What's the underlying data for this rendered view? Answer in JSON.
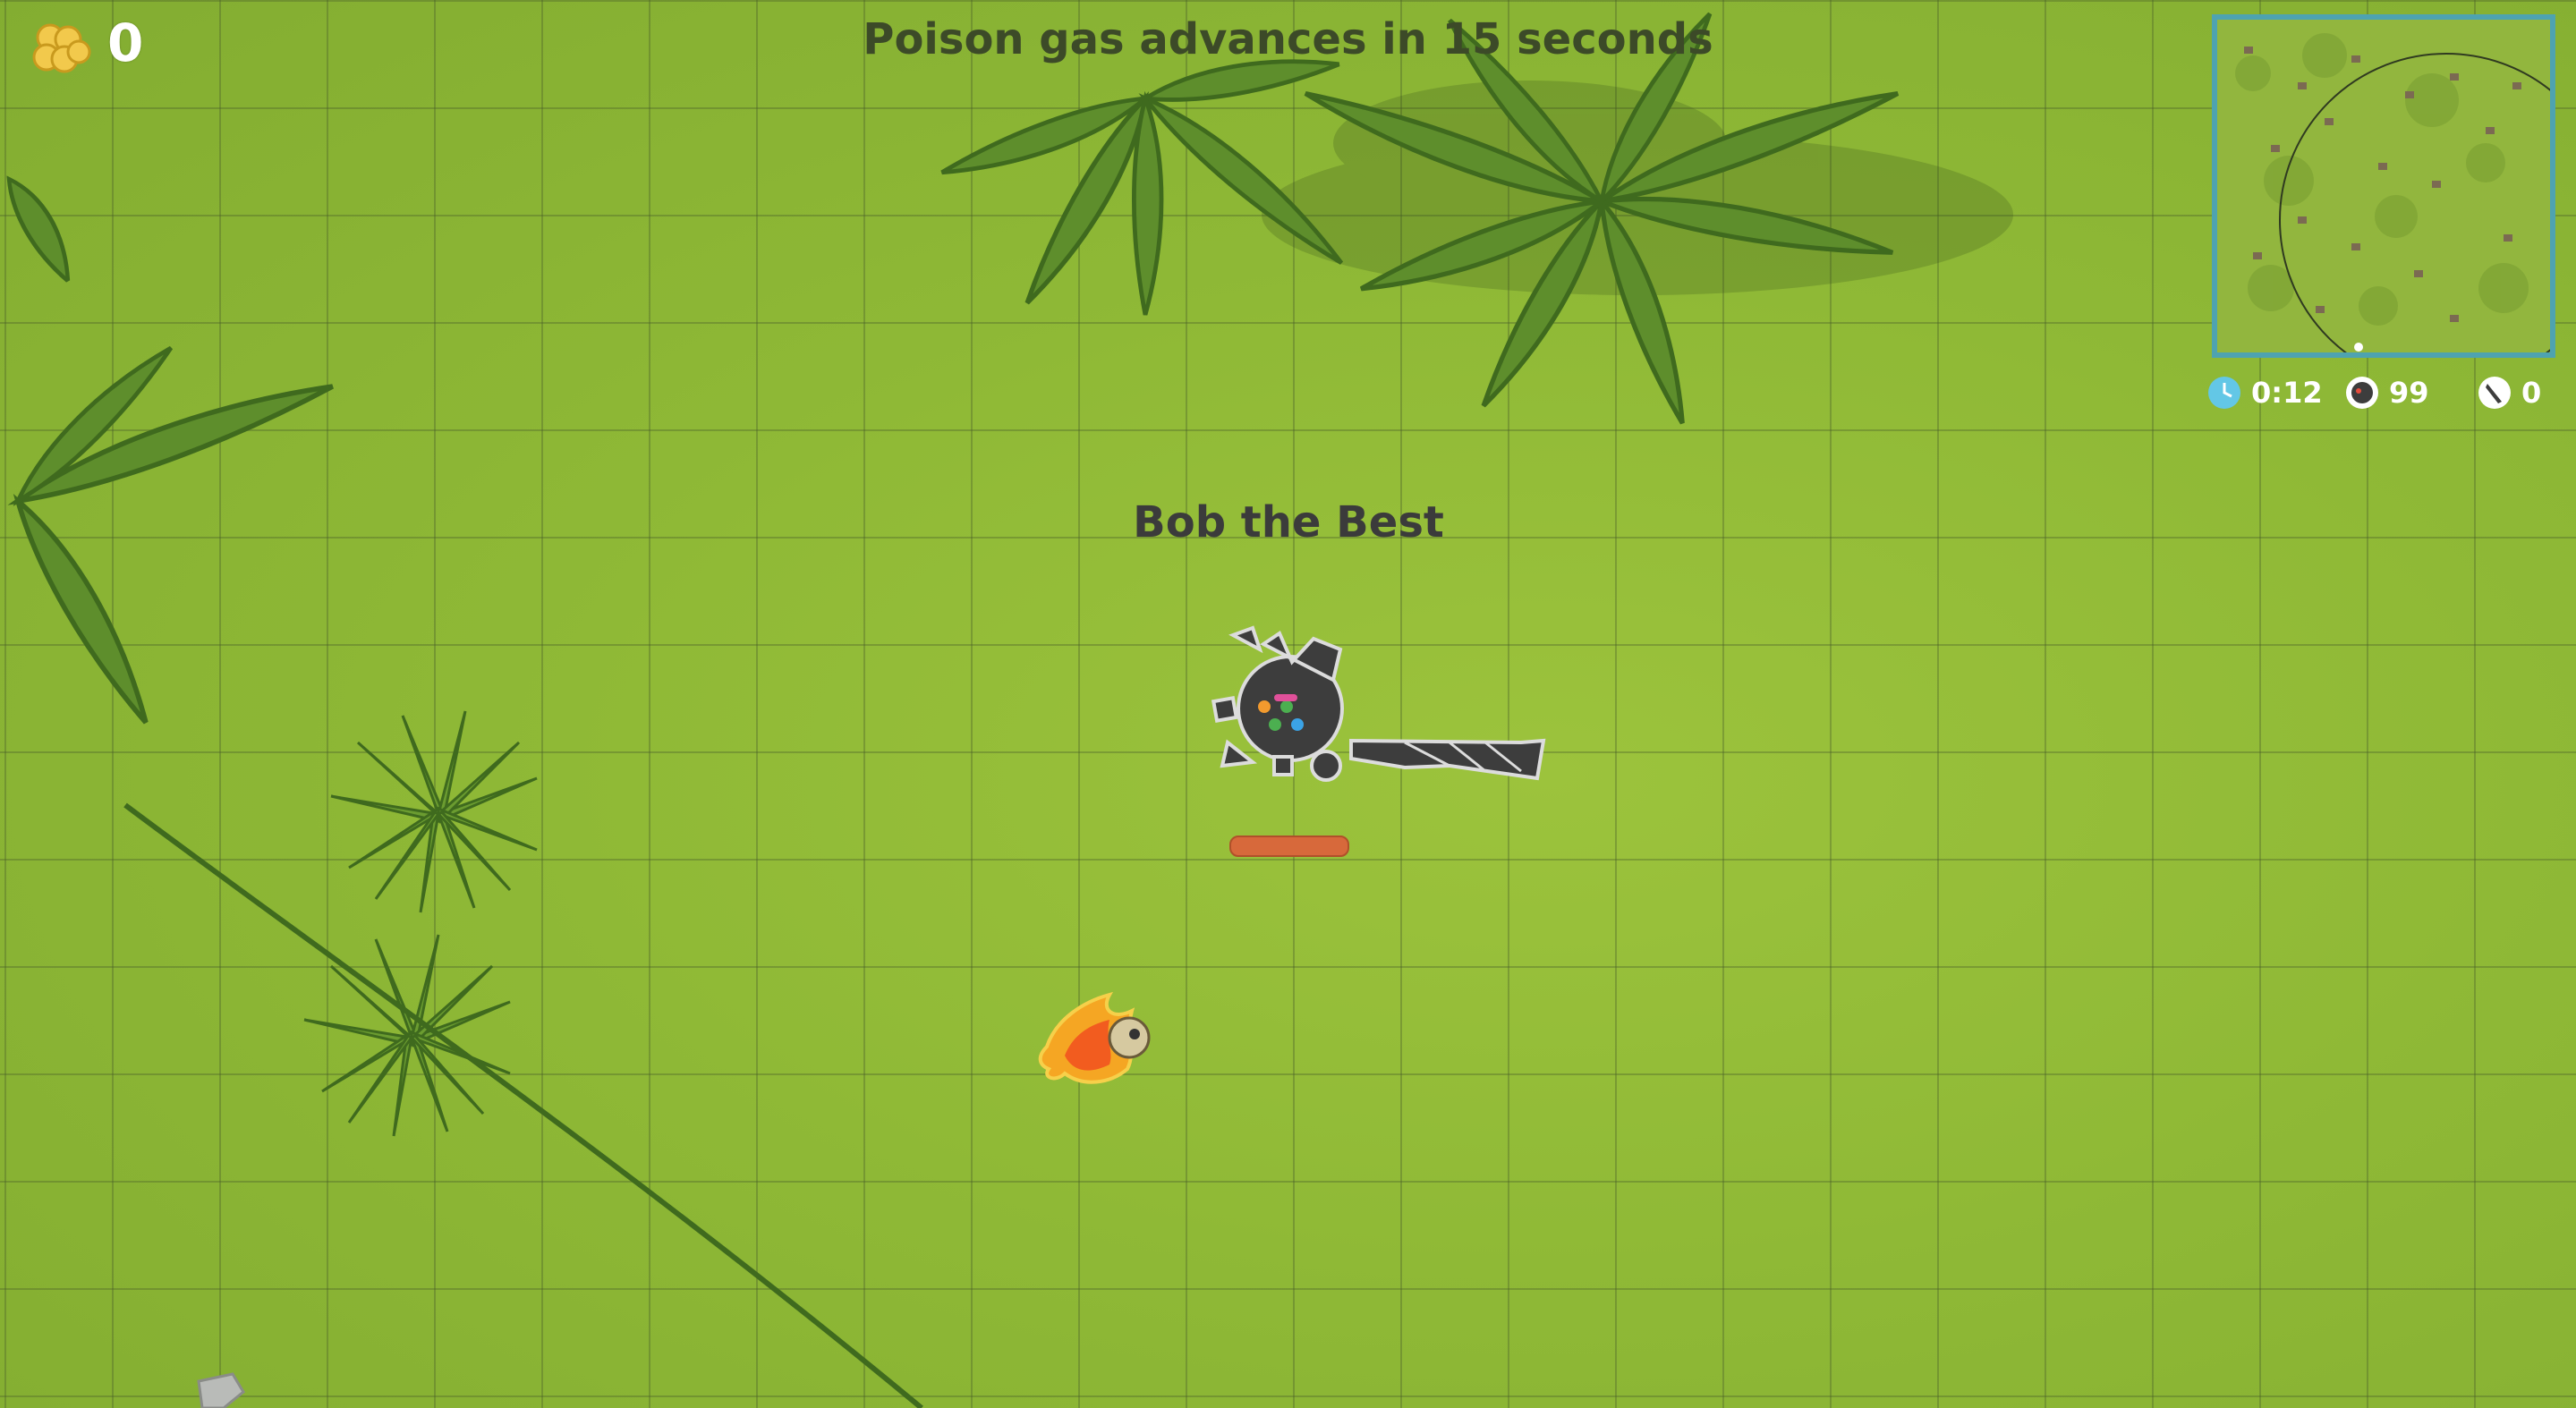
{
  "hud": {
    "coins": "0",
    "announcement": "Poison gas advances in 15 seconds"
  },
  "player": {
    "name": "Bob the Best"
  },
  "stats": {
    "time": "0:12",
    "players_alive": "99",
    "kills": "0"
  },
  "icons": {
    "coin": "coin-stack-icon",
    "time": "clock-icon",
    "players": "player-icon",
    "kills": "knife-icon"
  },
  "colors": {
    "grass": "#8fb936",
    "palm": "#5f8f2d",
    "minimap_border": "#4ea3b0",
    "health": "#d7693b",
    "clock": "#63c7e6"
  }
}
